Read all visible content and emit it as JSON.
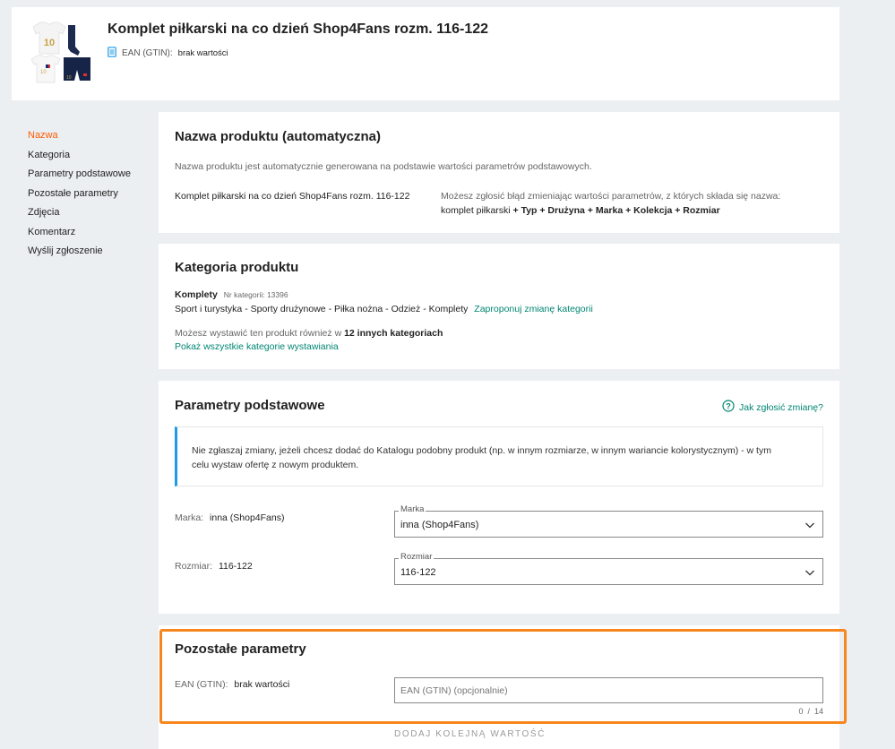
{
  "header": {
    "title": "Komplet piłkarski na co dzień Shop4Fans rozm. 116-122",
    "ean_label": "EAN (GTIN):",
    "ean_value": "brak wartości"
  },
  "sidenav": {
    "items": [
      {
        "label": "Nazwa",
        "active": true
      },
      {
        "label": "Kategoria"
      },
      {
        "label": "Parametry podstawowe"
      },
      {
        "label": "Pozostałe parametry"
      },
      {
        "label": "Zdjęcia"
      },
      {
        "label": "Komentarz"
      },
      {
        "label": "Wyślij zgłoszenie"
      }
    ]
  },
  "name_section": {
    "title": "Nazwa produktu (automatyczna)",
    "description": "Nazwa produktu jest automatycznie generowana na podstawie wartości parametrów podstawowych.",
    "product_name": "Komplet piłkarski na co dzień Shop4Fans rozm. 116-122",
    "hint": "Możesz zgłosić błąd zmieniając wartości parametrów, z których składa się nazwa:",
    "formula_prefix": "komplet piłkarski",
    "formula_parts": "+ Typ + Drużyna + Marka + Kolekcja + Rozmiar"
  },
  "category_section": {
    "title": "Kategoria produktu",
    "category_name": "Komplety",
    "category_number": "Nr kategorii: 13396",
    "path": "Sport i turystyka - Sporty drużynowe - Piłka nożna - Odzież - Komplety",
    "change_link": "Zaproponuj zmianę kategorii",
    "also_text": "Możesz wystawić ten produkt również w",
    "also_bold": "12 innych kategoriach",
    "show_all_link": "Pokaż wszystkie kategorie wystawiania"
  },
  "basic_section": {
    "title": "Parametry podstawowe",
    "help_link": "Jak zgłosić zmianę?",
    "info_line1": "Nie zgłaszaj zmiany, jeżeli chcesz dodać do Katalogu podobny produkt (np. w innym rozmiarze, w innym wariancie kolorystycznym) - w tym",
    "info_line2": "celu wystaw ofertę z nowym produktem.",
    "brand": {
      "label": "Marka:",
      "value": "inna (Shop4Fans)",
      "field_label": "Marka",
      "field_value": "inna (Shop4Fans)"
    },
    "size": {
      "label": "Rozmiar:",
      "value": "116-122",
      "field_label": "Rozmiar",
      "field_value": "116-122"
    }
  },
  "other_section": {
    "title": "Pozostałe parametry",
    "ean_label": "EAN (GTIN):",
    "ean_value": "brak wartości",
    "ean_placeholder": "EAN (GTIN) (opcjonalnie)",
    "counter": "0  /  14",
    "add_value": "DODAJ KOLEJNĄ WARTOŚĆ"
  },
  "colors": {
    "accent": "#ff5a00",
    "link": "#008673",
    "highlight": "#f7861d",
    "info_bar": "#1e9be2"
  }
}
